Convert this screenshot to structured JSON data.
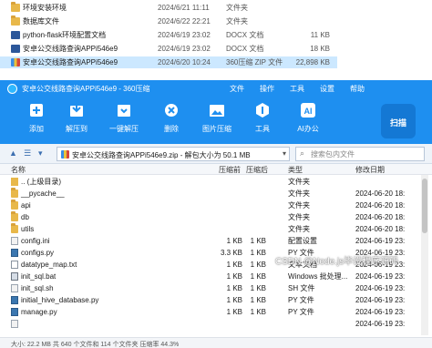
{
  "explorer": {
    "rows": [
      {
        "name": "环境安装环境",
        "date": "2024/6/21 11:11",
        "type": "文件夹",
        "size": "",
        "icon": "folder-icon"
      },
      {
        "name": "数据库文件",
        "date": "2024/6/22 22:21",
        "type": "文件夹",
        "size": "",
        "icon": "folder-icon"
      },
      {
        "name": "python-flask环境配置文档",
        "date": "2024/6/19 23:02",
        "type": "DOCX 文档",
        "size": "11 KB",
        "icon": "word-doc-icon"
      },
      {
        "name": "安卓公交线路查询APPi546e9",
        "date": "2024/6/19 23:02",
        "type": "DOCX 文档",
        "size": "18 KB",
        "icon": "word-doc-icon"
      },
      {
        "name": "安卓公交线路查询APPi546e9",
        "date": "2024/6/20 10:24",
        "type": "360压缩 ZIP 文件",
        "size": "22,898 KB",
        "icon": "zip-archive-icon",
        "selected": true
      }
    ]
  },
  "window": {
    "title": "安卓公交线路查询APPi546e9 - 360压缩",
    "menu": [
      "文件",
      "操作",
      "工具",
      "设置",
      "帮助"
    ],
    "toolbar": [
      {
        "label": "添加",
        "icon": "add-icon"
      },
      {
        "label": "解压到",
        "icon": "extract-to-icon"
      },
      {
        "label": "一键解压",
        "icon": "one-click-extract-icon"
      },
      {
        "label": "删除",
        "icon": "delete-icon"
      },
      {
        "label": "图片压缩",
        "icon": "image-compress-icon"
      },
      {
        "label": "工具",
        "icon": "tools-icon"
      },
      {
        "label": "AI办公",
        "icon": "ai-office-icon"
      }
    ],
    "scan_label": "扫描",
    "address": {
      "path": "安卓公交线路查询APPi546e9.zip - 解包大小为 50.1 MB",
      "search_placeholder": "搜索包内文件"
    },
    "columns": [
      "名称",
      "压缩前",
      "压缩后",
      "类型",
      "修改日期"
    ],
    "files": [
      {
        "name": ".. (上级目录)",
        "size": "",
        "csize": "",
        "type": "文件夹",
        "modified": "",
        "icon": "parent-folder-icon"
      },
      {
        "name": "__pycache__",
        "size": "",
        "csize": "",
        "type": "文件夹",
        "modified": "2024-06-20 18:",
        "icon": "folder-icon"
      },
      {
        "name": "api",
        "size": "",
        "csize": "",
        "type": "文件夹",
        "modified": "2024-06-20 18:",
        "icon": "folder-icon"
      },
      {
        "name": "db",
        "size": "",
        "csize": "",
        "type": "文件夹",
        "modified": "2024-06-20 18:",
        "icon": "folder-icon"
      },
      {
        "name": "utils",
        "size": "",
        "csize": "",
        "type": "文件夹",
        "modified": "2024-06-20 18:",
        "icon": "folder-icon"
      },
      {
        "name": "config.ini",
        "size": "1 KB",
        "csize": "1 KB",
        "type": "配置设置",
        "modified": "2024-06-19 23:",
        "icon": "ini-file-icon"
      },
      {
        "name": "configs.py",
        "size": "3.3 KB",
        "csize": "1 KB",
        "type": "PY 文件",
        "modified": "2024-06-19 23:",
        "icon": "python-file-icon"
      },
      {
        "name": "datatype_map.txt",
        "size": "1 KB",
        "csize": "1 KB",
        "type": "文本文档",
        "modified": "2024-06-19 23:",
        "icon": "text-file-icon"
      },
      {
        "name": "init_sql.bat",
        "size": "1 KB",
        "csize": "1 KB",
        "type": "Windows 批处理...",
        "modified": "2024-06-19 23:",
        "icon": "batch-file-icon"
      },
      {
        "name": "init_sql.sh",
        "size": "1 KB",
        "csize": "1 KB",
        "type": "SH 文件",
        "modified": "2024-06-19 23:",
        "icon": "shell-file-icon"
      },
      {
        "name": "initial_hive_database.py",
        "size": "1 KB",
        "csize": "1 KB",
        "type": "PY 文件",
        "modified": "2024-06-19 23:",
        "icon": "python-file-icon"
      },
      {
        "name": "manage.py",
        "size": "1 KB",
        "csize": "1 KB",
        "type": "PY 文件",
        "modified": "2024-06-19 23:",
        "icon": "python-file-icon"
      },
      {
        "name": "",
        "size": "",
        "csize": "",
        "type": "",
        "modified": "2024-06-19 23:",
        "icon": "file-icon"
      }
    ],
    "status": "大小: 22.2 MB 共 640 个文件和 114 个文件夹 压缩率 44.3%"
  },
  "watermark": "CSDN @Node.js毕设程序源码",
  "colors": {
    "titlebar": "#1e8ff0",
    "selection": "#cce8ff",
    "folder": "#e8b84a"
  }
}
